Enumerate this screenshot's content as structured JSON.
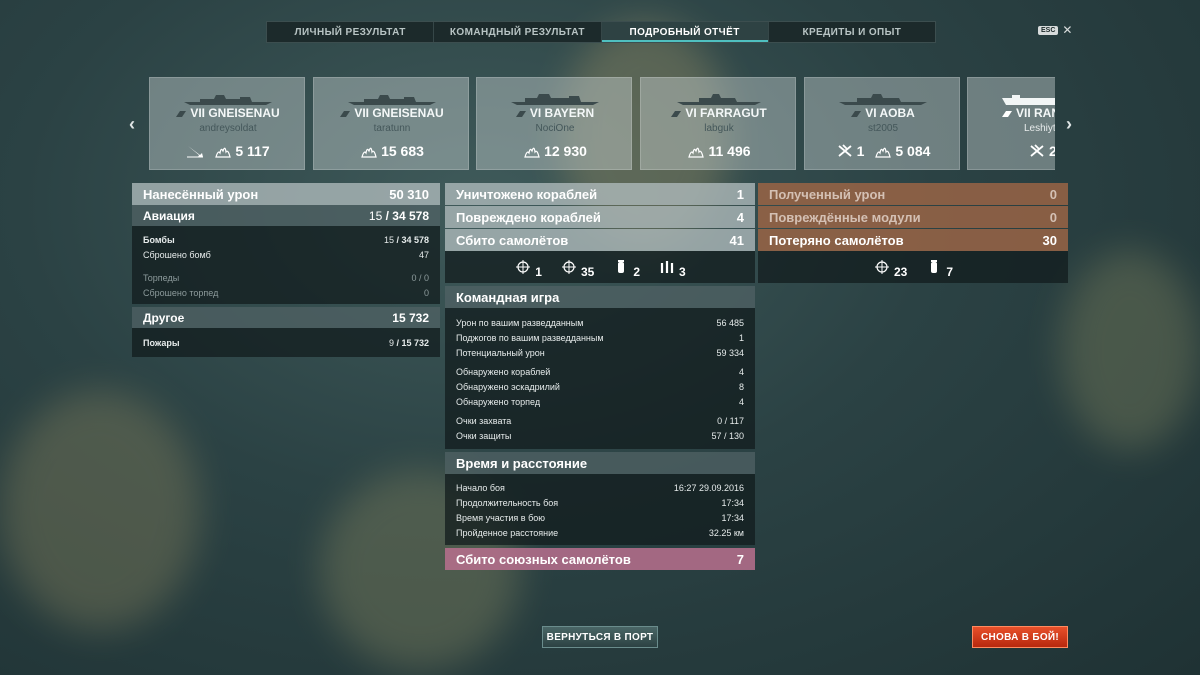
{
  "tabs": [
    {
      "label": "ЛИЧНЫЙ РЕЗУЛЬТАТ",
      "active": false
    },
    {
      "label": "КОМАНДНЫЙ РЕЗУЛЬТАТ",
      "active": false
    },
    {
      "label": "ПОДРОБНЫЙ ОТЧЁТ",
      "active": true
    },
    {
      "label": "КРЕДИТЫ И ОПЫТ",
      "active": false
    }
  ],
  "esc_key": "ESC",
  "ships": [
    {
      "name": "VII GNEISENAU",
      "player": "andreysoldat",
      "stats": [
        {
          "icon": "ship-sunk-icon",
          "value": ""
        },
        {
          "icon": "fire-icon",
          "value": "5 117"
        }
      ]
    },
    {
      "name": "VII GNEISENAU",
      "player": "taratunn",
      "stats": [
        {
          "icon": "fire-icon",
          "value": "15 683"
        }
      ]
    },
    {
      "name": "VI BAYERN",
      "player": "NociOne",
      "stats": [
        {
          "icon": "fire-icon",
          "value": "12 930"
        }
      ]
    },
    {
      "name": "VI FARRAGUT",
      "player": "labguk",
      "stats": [
        {
          "icon": "fire-icon",
          "value": "11 496"
        }
      ]
    },
    {
      "name": "VI AOBA",
      "player": "st2005",
      "stats": [
        {
          "icon": "plane-down-icon",
          "value": "1"
        },
        {
          "icon": "fire-icon",
          "value": "5 084"
        }
      ]
    },
    {
      "name": "VII RAN",
      "player": "Leshiyt",
      "stats": [
        {
          "icon": "plane-down-icon",
          "value": "2"
        }
      ]
    }
  ],
  "left": {
    "damage": {
      "label": "Нанесённый урон",
      "value": "50 310"
    },
    "aviation": {
      "label": "Авиация",
      "value_a": "15",
      "value_b": "34 578"
    },
    "bombs": {
      "label": "Бомбы",
      "value_a": "15",
      "value_b": "34 578"
    },
    "bombs_dropped": {
      "label": "Сброшено бомб",
      "value": "47"
    },
    "torpedoes": {
      "label": "Торпеды",
      "value": "0 / 0"
    },
    "torpedoes_dropped": {
      "label": "Сброшено торпед",
      "value": "0"
    },
    "other": {
      "label": "Другое",
      "value": "15 732"
    },
    "fires": {
      "label": "Пожары",
      "value_a": "9",
      "value_b": "15 732"
    }
  },
  "middle": {
    "destroyed": {
      "label": "Уничтожено кораблей",
      "value": "1"
    },
    "damaged": {
      "label": "Повреждено кораблей",
      "value": "4"
    },
    "planes_shot": {
      "label": "Сбито самолётов",
      "value": "41"
    },
    "icon_stats": [
      {
        "icon": "crosshair-icon",
        "value": "1"
      },
      {
        "icon": "crosshair-icon",
        "value": "35"
      },
      {
        "icon": "bomb-icon",
        "value": "2"
      },
      {
        "icon": "shells-icon",
        "value": "3"
      }
    ],
    "team": {
      "title": "Командная игра",
      "rows": [
        {
          "label": "Урон по вашим разведданным",
          "value": "56 485"
        },
        {
          "label": "Поджогов по вашим разведданным",
          "value": "1"
        },
        {
          "label": "Потенциальный урон",
          "value": "59 334"
        },
        {
          "label": "Обнаружено кораблей",
          "value": "4"
        },
        {
          "label": "Обнаружено эскадрилий",
          "value": "8"
        },
        {
          "label": "Обнаружено торпед",
          "value": "4"
        },
        {
          "label": "Очки захвата",
          "value": "0 / 117"
        },
        {
          "label": "Очки защиты",
          "value": "57 / 130"
        }
      ]
    },
    "time": {
      "title": "Время и расстояние",
      "rows": [
        {
          "label": "Начало боя",
          "value": "16:27  29.09.2016"
        },
        {
          "label": "Продолжительность боя",
          "value": "17:34"
        },
        {
          "label": "Время участия в бою",
          "value": "17:34"
        },
        {
          "label": "Пройденное расстояние",
          "value": "32.25 км"
        }
      ]
    },
    "allied_planes": {
      "label": "Сбито союзных самолётов",
      "value": "7"
    }
  },
  "right": {
    "received": {
      "label": "Полученный урон",
      "value": "0"
    },
    "modules": {
      "label": "Повреждённые модули",
      "value": "0"
    },
    "planes_lost": {
      "label": "Потеряно самолётов",
      "value": "30"
    },
    "icon_stats": [
      {
        "icon": "crosshair-icon",
        "value": "23"
      },
      {
        "icon": "bomb-icon",
        "value": "7"
      }
    ]
  },
  "buttons": {
    "port": "ВЕРНУТЬСЯ В ПОРТ",
    "battle": "СНОВА В БОЙ!"
  },
  "colors": {
    "accent": "#4fc0c0",
    "battle_button": "#d8401c",
    "received_header": "#9e6546",
    "allied_header": "#b8708e"
  }
}
